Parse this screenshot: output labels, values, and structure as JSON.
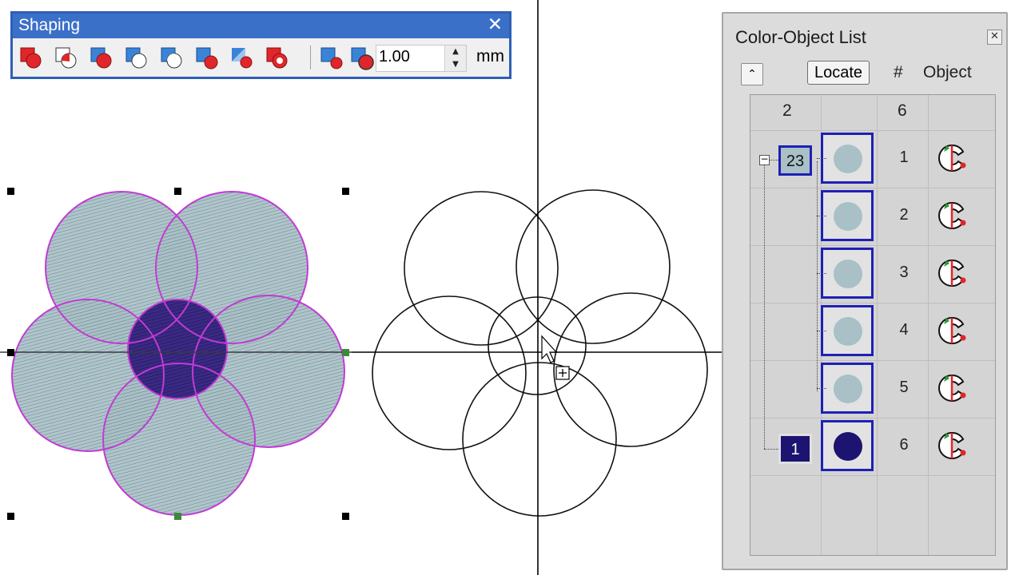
{
  "shaping": {
    "title": "Shaping",
    "close_label": "✕",
    "tools": [
      {
        "name": "combine-icon"
      },
      {
        "name": "intersect-icon"
      },
      {
        "name": "subtract-icon"
      },
      {
        "name": "exclude-icon"
      },
      {
        "name": "separate-icon"
      },
      {
        "name": "trim-icon"
      },
      {
        "name": "divide-icon"
      },
      {
        "name": "remove-overlap-icon"
      },
      {
        "name": "trim-outline-icon"
      },
      {
        "name": "offset-icon"
      }
    ],
    "offset_value": "1.00",
    "unit": "mm"
  },
  "color_object_list": {
    "title": "Color-Object List",
    "close_label": "✕",
    "collapse_label": "⌃",
    "locate_label": "Locate",
    "col_hash": "#",
    "col_object": "Object",
    "color_count": "2",
    "object_count": "6",
    "groups": [
      {
        "color_label": "23",
        "color_hex": "#a8c0c6"
      },
      {
        "color_label": "1",
        "color_hex": "#1c1470"
      }
    ],
    "rows": [
      {
        "num": "1",
        "swatch": "#a8c0c6"
      },
      {
        "num": "2",
        "swatch": "#a8c0c6"
      },
      {
        "num": "3",
        "swatch": "#a8c0c6"
      },
      {
        "num": "4",
        "swatch": "#a8c0c6"
      },
      {
        "num": "5",
        "swatch": "#a8c0c6"
      },
      {
        "num": "6",
        "swatch": "#1c1470"
      }
    ]
  },
  "colors": {
    "accent": "#3b70c9",
    "selection_outline": "#c23ad4",
    "stitch_fill": "#a8c0c6",
    "center_fill": "#3a2a82",
    "icon_red": "#e0262b",
    "icon_blue": "#3a84d8"
  }
}
